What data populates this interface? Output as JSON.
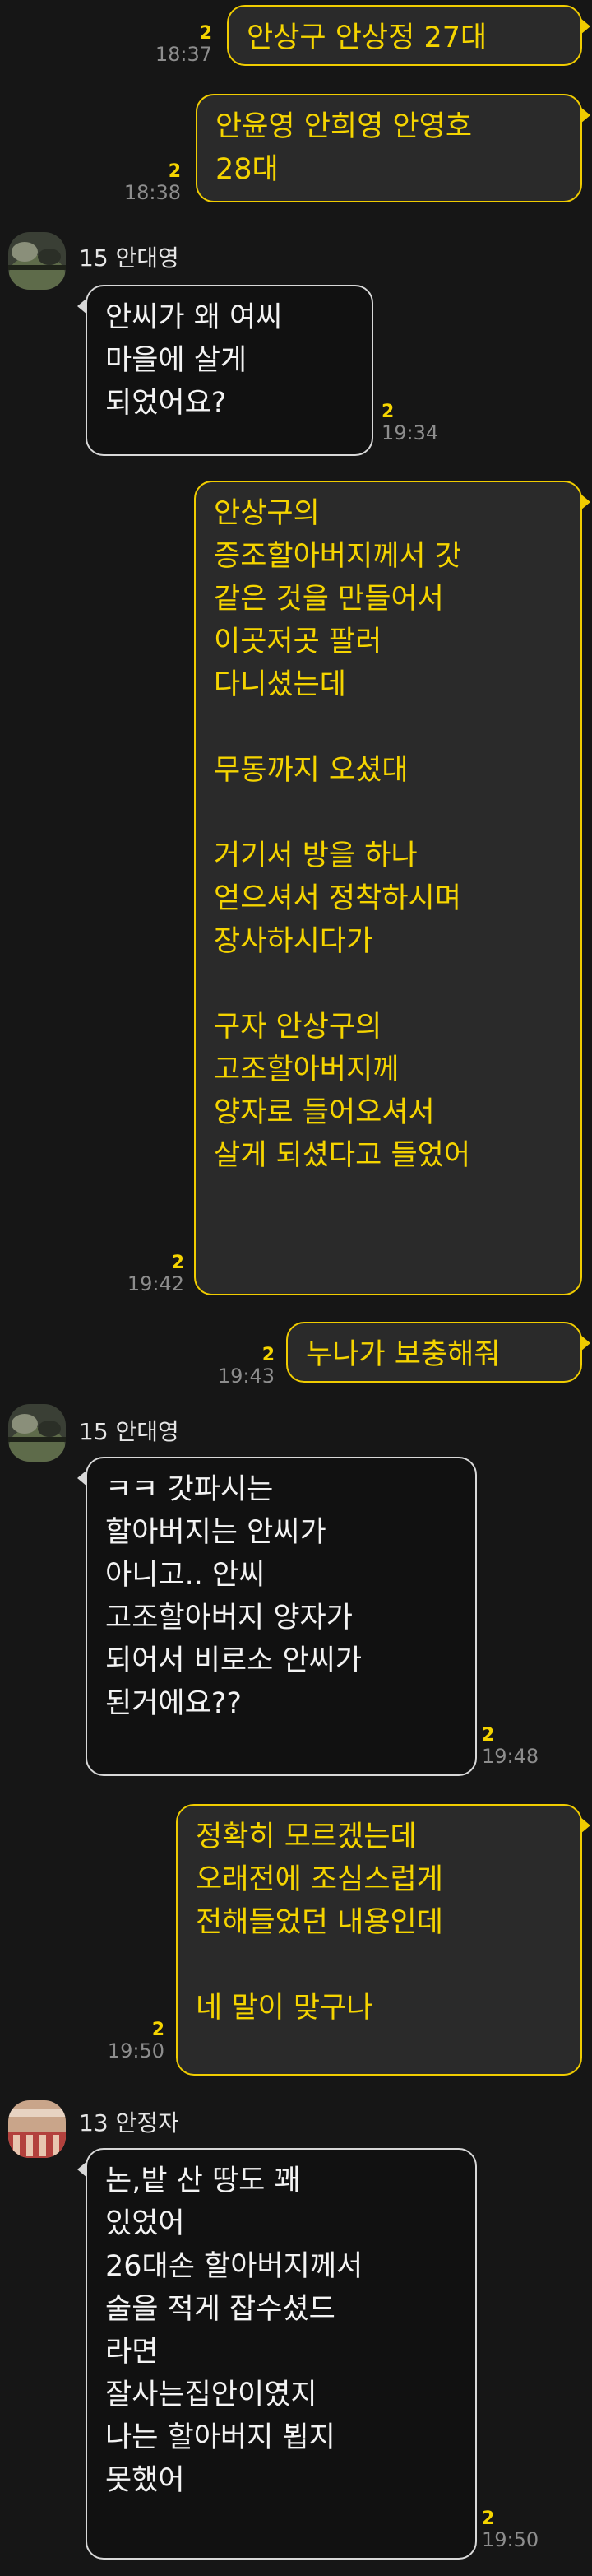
{
  "messages": [
    {
      "side": "me",
      "lines": "안상구 안상정 27대",
      "count": "2",
      "time": "18:37"
    },
    {
      "side": "me",
      "lines": "안윤영 안희영 안영호\n28대",
      "count": "2",
      "time": "18:38"
    },
    {
      "side": "other",
      "sender": "15 안대영",
      "lines": "안씨가 왜 여씨\n마을에 살게\n되었어요?",
      "count": "2",
      "time": "19:34"
    },
    {
      "side": "me",
      "lines": "안상구의\n증조할아버지께서 갓\n같은 것을 만들어서\n이곳저곳 팔러\n다니셨는데\n\n무동까지 오셨대\n\n거기서 방을 하나\n얻으셔서 정착하시며\n장사하시다가\n\n구자 안상구의\n고조할아버지께\n양자로 들어오셔서\n살게 되셨다고 들었어",
      "count": "2",
      "time": "19:42"
    },
    {
      "side": "me",
      "lines": "누나가 보충해줘",
      "count": "2",
      "time": "19:43"
    },
    {
      "side": "other",
      "sender": "15 안대영",
      "lines": "ㅋㅋ 갓파시는\n할아버지는 안씨가\n아니고.. 안씨\n고조할아버지 양자가\n되어서 비로소 안씨가\n된거에요??",
      "count": "2",
      "time": "19:48"
    },
    {
      "side": "me",
      "lines": "정확히 모르겠는데\n오래전에 조심스럽게\n전해들었던 내용인데\n\n네 말이 맞구나",
      "count": "2",
      "time": "19:50"
    },
    {
      "side": "other",
      "sender": "13 안정자",
      "lines": "논,밭 산 땅도 꽤\n있었어\n26대손 할아버지께서\n술을 적게 잡수셨드\n라면\n잘사는집안이였지\n나는 할아버지 뵙지\n못했어",
      "count": "2",
      "time": "19:50"
    }
  ]
}
